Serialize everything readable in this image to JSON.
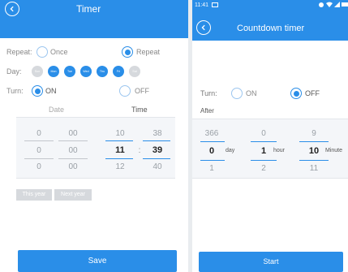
{
  "left": {
    "header": {
      "title": "Timer"
    },
    "repeat": {
      "label": "Repeat:",
      "option_once": "Once",
      "option_repeat": "Repeat"
    },
    "day": {
      "label": "Day:",
      "items": [
        {
          "label": "Sun",
          "active": false
        },
        {
          "label": "Mon",
          "active": true
        },
        {
          "label": "Tue",
          "active": true
        },
        {
          "label": "Wed",
          "active": true
        },
        {
          "label": "Thu",
          "active": true
        },
        {
          "label": "Fri",
          "active": true
        },
        {
          "label": "Sat",
          "active": false
        }
      ]
    },
    "turn": {
      "label": "Turn:",
      "on": "ON",
      "off": "OFF"
    },
    "headers": {
      "date": "Date",
      "time": "Time"
    },
    "picker": {
      "rows": [
        [
          "0",
          "00",
          "10",
          "38"
        ],
        [
          "0",
          "00",
          "11",
          "39"
        ],
        [
          "0",
          "00",
          "12",
          "40"
        ]
      ],
      "time_separator": ":"
    },
    "year_buttons": {
      "this_year": "This year",
      "next_year": "Next year"
    },
    "save_label": "Save"
  },
  "right": {
    "status": {
      "time": "11:41"
    },
    "header": {
      "title": "Countdown timer"
    },
    "turn": {
      "label": "Turn:",
      "on": "ON",
      "off": "OFF"
    },
    "after_label": "After",
    "picker": {
      "rows": [
        [
          "366",
          "0",
          "9"
        ],
        [
          "0",
          "1",
          "10"
        ],
        [
          "1",
          "2",
          "11"
        ]
      ],
      "units": {
        "day": "day",
        "hour": "hour",
        "minute": "Minute"
      }
    },
    "start_label": "Start"
  },
  "colors": {
    "accent": "#2a8ee8",
    "inactive": "#d6d9dd",
    "divider": "#e9ecef"
  }
}
